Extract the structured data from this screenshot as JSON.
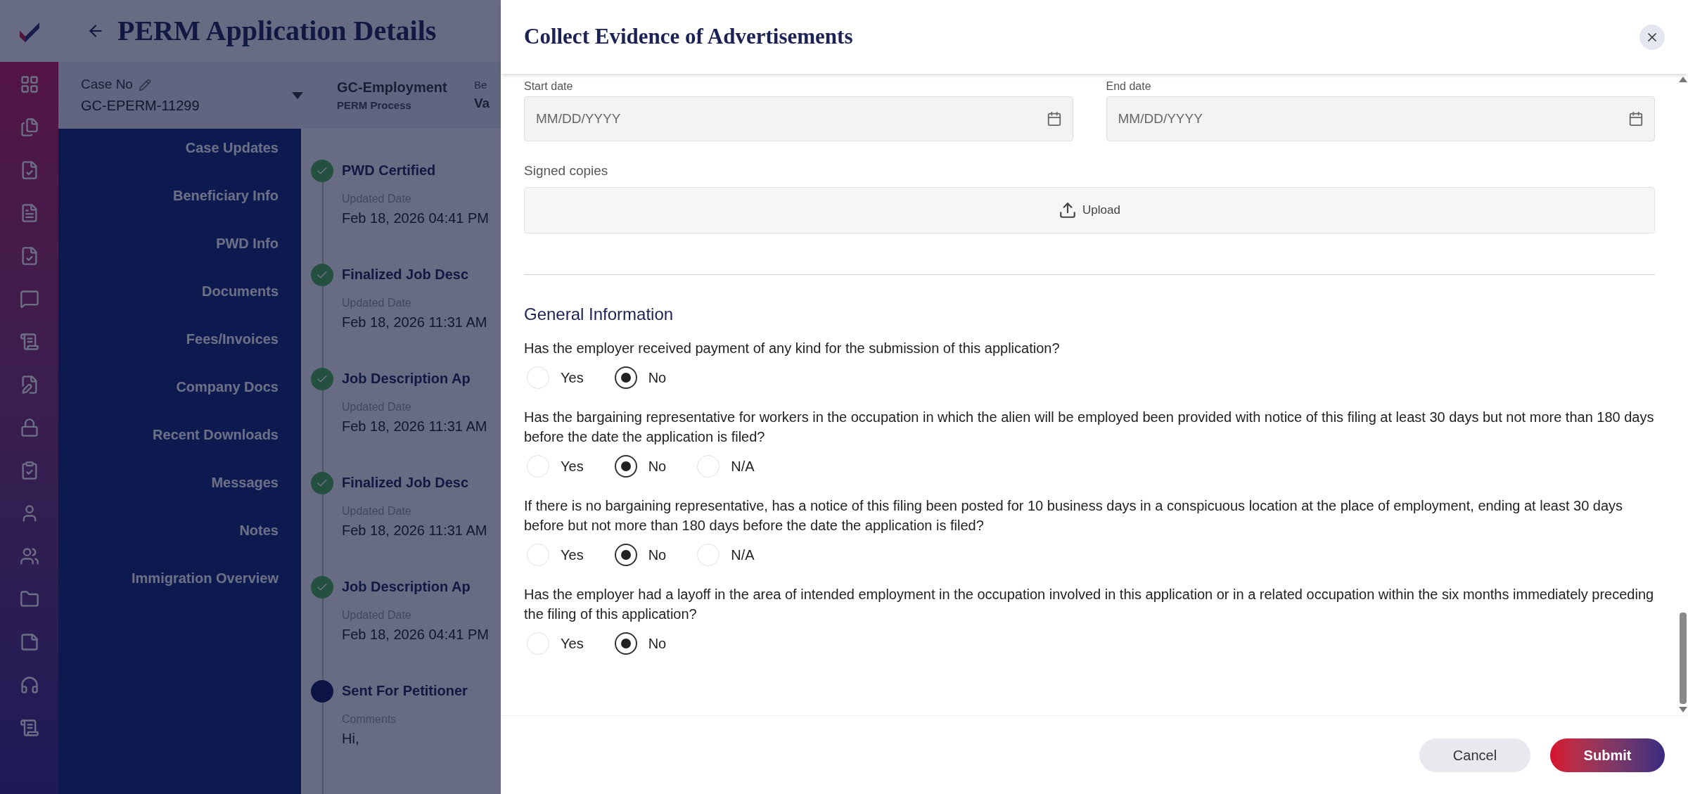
{
  "app": {
    "title": "PERM Application Details"
  },
  "case_bar": {
    "case_label": "Case No",
    "case_value": "GC-EPERM-11299",
    "process_title": "GC-Employment",
    "process_sub": "PERM Process",
    "column_3_label": "Be",
    "column_3_value": "Va"
  },
  "nav": [
    {
      "label": "Case Updates"
    },
    {
      "label": "Beneficiary Info"
    },
    {
      "label": "PWD Info"
    },
    {
      "label": "Documents"
    },
    {
      "label": "Fees/Invoices"
    },
    {
      "label": "Company Docs"
    },
    {
      "label": "Recent Downloads"
    },
    {
      "label": "Messages"
    },
    {
      "label": "Notes"
    },
    {
      "label": "Immigration Overview"
    }
  ],
  "timeline": [
    {
      "title": "PWD Certified",
      "kind": "done",
      "label": "Updated Date",
      "value": "Feb 18, 2026 04:41 PM"
    },
    {
      "title": "Finalized Job Desc",
      "kind": "done",
      "label": "Updated Date",
      "value": "Feb 18, 2026 11:31 AM"
    },
    {
      "title": "Job Description Ap",
      "kind": "done",
      "label": "Updated Date",
      "value": "Feb 18, 2026 11:31 AM"
    },
    {
      "title": "Finalized Job Desc",
      "kind": "done",
      "label": "Updated Date",
      "value": "Feb 18, 2026 11:31 AM"
    },
    {
      "title": "Job Description Ap",
      "kind": "done",
      "label": "Updated Date",
      "value": "Feb 18, 2026 04:41 PM"
    },
    {
      "title": "Sent For Petitioner",
      "kind": "current",
      "label": "Comments",
      "value": "Hi,"
    }
  ],
  "modal": {
    "title": "Collect Evidence of Advertisements",
    "dates": [
      {
        "label": "Start date",
        "placeholder": "MM/DD/YYYY"
      },
      {
        "label": "End date",
        "placeholder": "MM/DD/YYYY"
      }
    ],
    "upload": {
      "label": "Signed copies",
      "button": "Upload"
    },
    "section": "General Information",
    "questions": [
      {
        "text": "Has the employer received payment of any kind for the submission of this application?",
        "options": [
          {
            "label": "Yes",
            "selected": false
          },
          {
            "label": "No",
            "selected": true
          }
        ]
      },
      {
        "text": "Has the bargaining representative for workers in the occupation in which the alien will be employed been provided with notice of this filing at least 30 days but not more than 180 days before the date the application is filed?",
        "options": [
          {
            "label": "Yes",
            "selected": false
          },
          {
            "label": "No",
            "selected": true
          },
          {
            "label": "N/A",
            "selected": false
          }
        ]
      },
      {
        "text": "If there is no bargaining representative, has a notice of this filing been posted for 10 business days in a conspicuous location at the place of employment, ending at least 30 days before but not more than 180 days before the date the application is filed?",
        "options": [
          {
            "label": "Yes",
            "selected": false
          },
          {
            "label": "No",
            "selected": true
          },
          {
            "label": "N/A",
            "selected": false
          }
        ]
      },
      {
        "text": "Has the employer had a layoff in the area of intended employment in the occupation involved in this application or in a related occupation within the six months immediately preceding the filing of this application?",
        "options": [
          {
            "label": "Yes",
            "selected": false
          },
          {
            "label": "No",
            "selected": true
          }
        ]
      }
    ],
    "buttons": [
      {
        "label": "Cancel",
        "kind": "secondary"
      },
      {
        "label": "Submit",
        "kind": "primary"
      }
    ]
  }
}
